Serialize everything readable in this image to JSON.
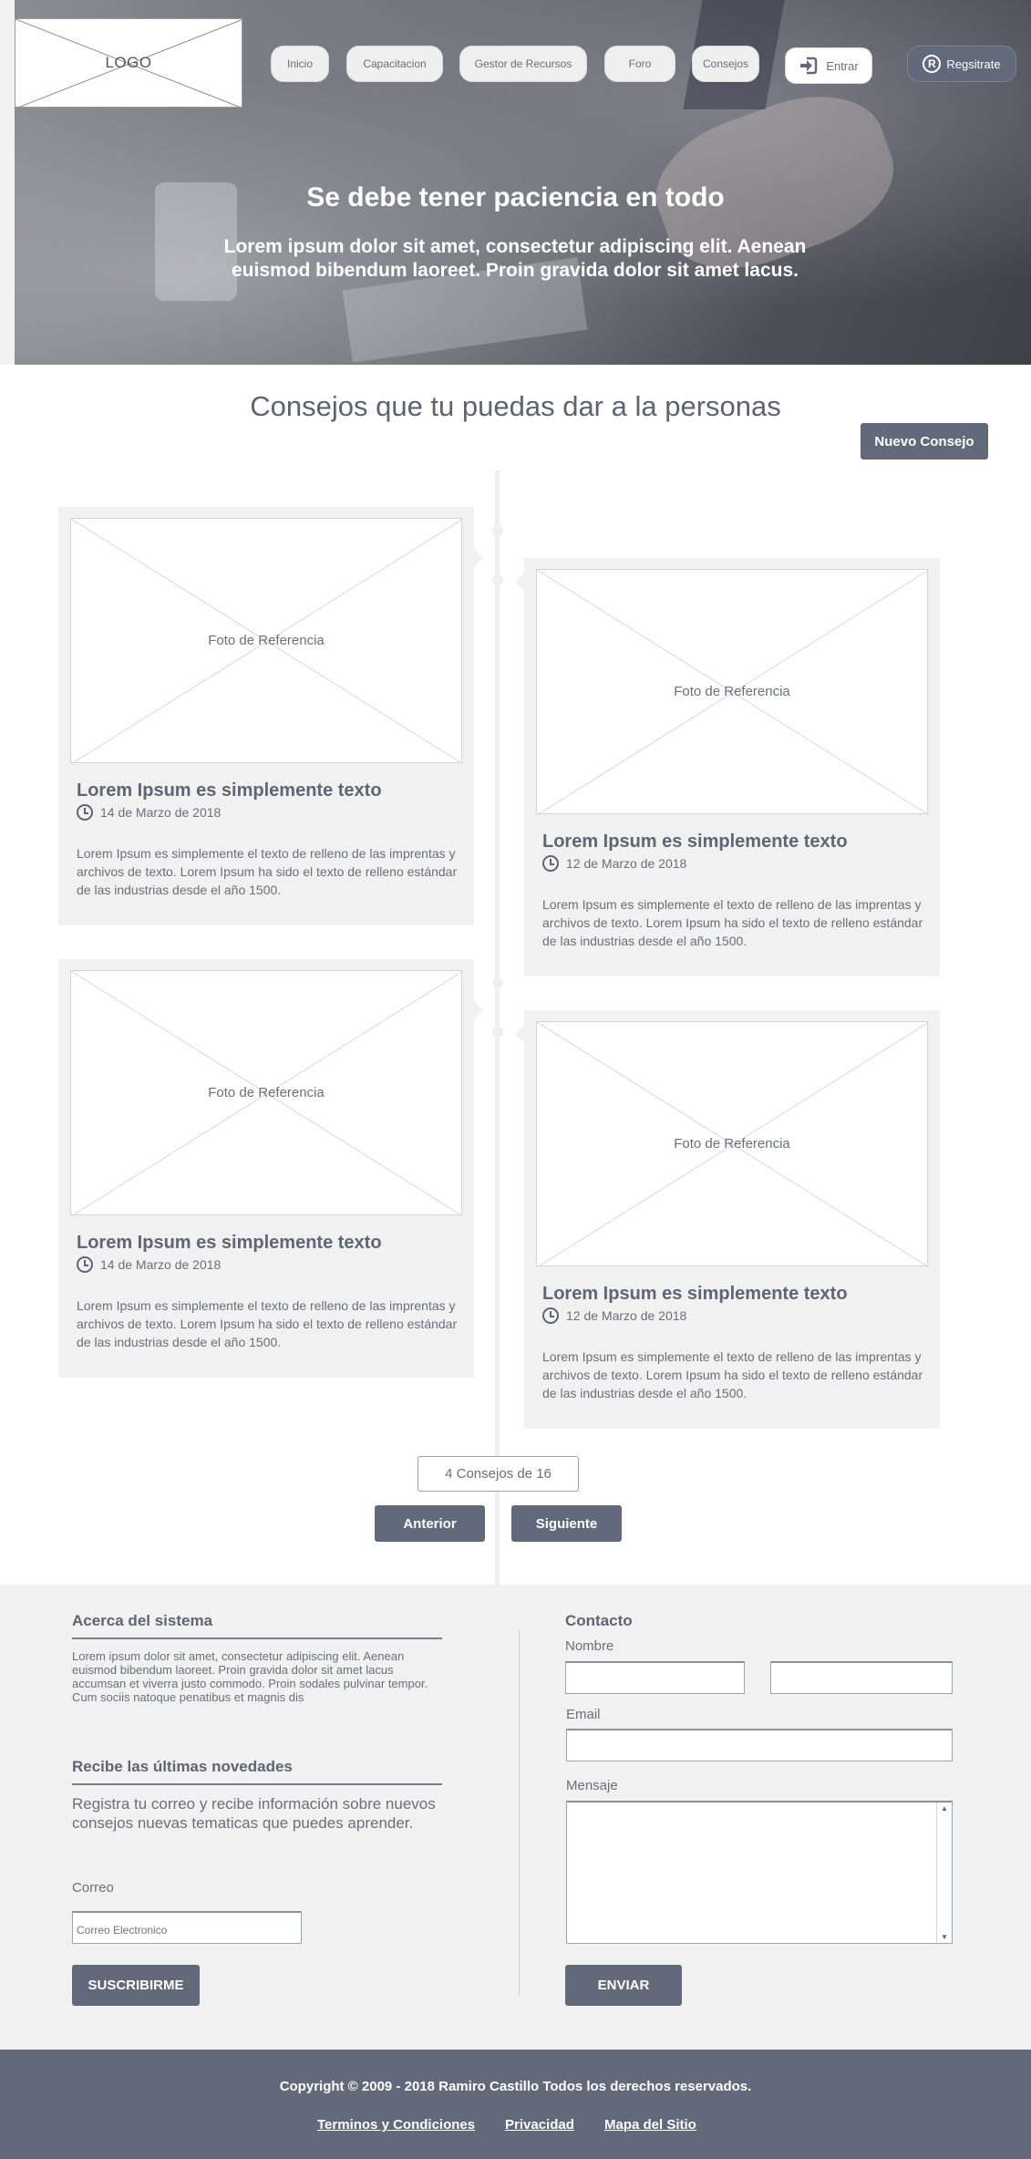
{
  "header": {
    "logo_text": "LOGO",
    "nav": {
      "inicio": "Inicio",
      "capacitacion": "Capacitacion",
      "gestor": "Gestor de Recursos",
      "foro": "Foro",
      "consejos": "Consejos",
      "entrar": "Entrar",
      "registrate": "Regsitrate",
      "registrate_badge": "R"
    }
  },
  "hero": {
    "title": "Se debe tener paciencia en todo",
    "subtitle": "Lorem ipsum dolor sit amet, consectetur adipiscing elit. Aenean euismod bibendum laoreet. Proin gravida dolor sit amet lacus."
  },
  "tips": {
    "section_title": "Consejos que tu puedas dar a la personas",
    "new_tip_button": "Nuevo Consejo",
    "cards": [
      {
        "image_label": "Foto de Referencia",
        "title": "Lorem Ipsum es simplemente texto",
        "date": "14 de Marzo de 2018",
        "body": "Lorem Ipsum es simplemente el texto de relleno de las imprentas y archivos de texto. Lorem Ipsum ha sido el texto de relleno estándar de las industrias desde el año 1500."
      },
      {
        "image_label": "Foto de Referencia",
        "title": "Lorem Ipsum es simplemente texto",
        "date": "12 de Marzo de 2018",
        "body": "Lorem Ipsum es simplemente el texto de relleno de las imprentas y archivos de texto. Lorem Ipsum ha sido el texto de relleno estándar de las industrias desde el año 1500."
      },
      {
        "image_label": "Foto de Referencia",
        "title": "Lorem Ipsum es simplemente texto",
        "date": "14 de Marzo de 2018",
        "body": "Lorem Ipsum es simplemente el texto de relleno de las imprentas y archivos de texto. Lorem Ipsum ha sido el texto de relleno estándar de las industrias desde el año 1500."
      },
      {
        "image_label": "Foto de Referencia",
        "title": "Lorem Ipsum es simplemente texto",
        "date": "12 de Marzo de 2018",
        "body": "Lorem Ipsum es simplemente el texto de relleno de las imprentas y archivos de texto. Lorem Ipsum ha sido el texto de relleno estándar de las industrias desde el año 1500."
      }
    ],
    "counter": "4 Consejos de 16",
    "prev_button": "Anterior",
    "next_button": "Siguiente"
  },
  "footer_forms": {
    "about": {
      "heading": "Acerca del sistema",
      "text": "Lorem ipsum dolor sit amet, consectetur adipiscing elit. Aenean euismod bibendum laoreet. Proin gravida dolor sit amet lacus accumsan et viverra justo commodo. Proin sodales pulvinar tempor. Cum sociis natoque penatibus et magnis dis"
    },
    "newsletter": {
      "heading": "Recibe las últimas novedades",
      "text": "Registra tu correo y recibe información sobre nuevos consejos nuevas tematicas que puedes aprender.",
      "email_label": "Correo",
      "email_placeholder": "Correo Electronico",
      "subscribe_button": "SUSCRIBIRME"
    },
    "contact": {
      "heading": "Contacto",
      "name_label": "Nombre",
      "email_label": "Email",
      "message_label": "Mensaje",
      "send_button": "ENVIAR"
    }
  },
  "bottom_footer": {
    "copyright": "Copyright © 2009 - 2018 Ramiro Castillo Todos los derechos reservados.",
    "links": {
      "terms": "Terminos y  Condiciones",
      "privacy": "Privacidad",
      "sitemap": "Mapa del Sitio"
    }
  },
  "colors": {
    "primary": "#61697b",
    "card_bg": "#f1f1f1",
    "text": "#5f6777"
  }
}
